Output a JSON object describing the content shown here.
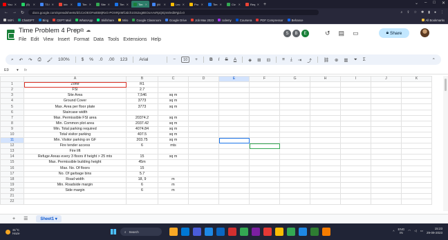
{
  "browser": {
    "tabs": [
      {
        "label": "You",
        "color": "#ff0000"
      },
      {
        "label": "(5)",
        "color": "#25d366"
      },
      {
        "label": "T3 /",
        "color": "#4285f4"
      },
      {
        "label": "Inb",
        "color": "#ea4335"
      },
      {
        "label": "Tim",
        "color": "#1a73e8"
      },
      {
        "label": "Site",
        "color": "#34a853"
      },
      {
        "label": "Tim",
        "color": "#1a73e8"
      },
      {
        "label": "Tim",
        "color": "#188038",
        "active": true
      },
      {
        "label": "(M",
        "color": "#4285f4"
      },
      {
        "label": "Lec",
        "color": "#fbbc04"
      },
      {
        "label": "Pro",
        "color": "#fbbc04"
      },
      {
        "label": "Tim",
        "color": "#1a73e8"
      },
      {
        "label": "Civ",
        "color": "#34a853"
      },
      {
        "label": "Req",
        "color": "#ea4335"
      }
    ],
    "new_tab": "+",
    "window_controls": [
      "⌄",
      "–",
      "□",
      "✕"
    ],
    "url": "docs.google.com/spreadsheets/d/1CxOEOFwEB8jRxG-POXRj4MfiJdch1G52xg8EOxAAvRpQEjm8/edit#gid=0",
    "bookmarks": [
      {
        "label": "WiFi",
        "color": "#cccccc"
      },
      {
        "label": "ChatGPT",
        "color": "#10a37f"
      },
      {
        "label": "Bing",
        "color": "#0078d4"
      },
      {
        "label": "CEPT Mail",
        "color": "#ea4335"
      },
      {
        "label": "WhatsApp",
        "color": "#25d366"
      },
      {
        "label": "Skillshare",
        "color": "#00ff84"
      },
      {
        "label": "Miro",
        "color": "#ffd02f"
      },
      {
        "label": "Google Classroom",
        "color": "#34a853"
      },
      {
        "label": "Google Drive",
        "color": "#4285f4"
      },
      {
        "label": "Job Max 2023",
        "color": "#ea4335"
      },
      {
        "label": "Udemy",
        "color": "#a435f0"
      },
      {
        "label": "Coursera",
        "color": "#0056d2"
      },
      {
        "label": "PDF Compressor",
        "color": "#e53935"
      },
      {
        "label": "Behance",
        "color": "#1769ff"
      }
    ],
    "all_bookmarks": "All Bookmarks"
  },
  "doc": {
    "title": "Time Problem 4 Prep",
    "menu": [
      "File",
      "Edit",
      "View",
      "Insert",
      "Format",
      "Data",
      "Tools",
      "Extensions",
      "Help"
    ],
    "collaborators": [
      {
        "initial": "S",
        "color": "#5f6368"
      },
      {
        "initial": "B",
        "color": "#5f6368"
      },
      {
        "initial": "E",
        "color": "#188038"
      }
    ],
    "share_label": "Share"
  },
  "toolbar": {
    "zoom": "100%",
    "currency": "$",
    "percent": "%",
    "dec_less": ".0",
    "dec_more": ".00",
    "number_format": "123",
    "font": "Arial",
    "font_size": "10"
  },
  "formula_bar": {
    "cell_ref": "E9",
    "fx": "fx",
    "value": ""
  },
  "grid": {
    "columns": [
      "A",
      "B",
      "C",
      "D",
      "E",
      "F",
      "G",
      "H",
      "I",
      "J",
      "K"
    ],
    "selected_column": "E",
    "rows": [
      {
        "n": "1",
        "a": "Zone",
        "b": "R1",
        "c": ""
      },
      {
        "n": "2",
        "a": "FSI",
        "b": "2.7",
        "c": ""
      },
      {
        "n": "3",
        "a": "Site Area",
        "b": "7,546",
        "c": "sq m"
      },
      {
        "n": "4",
        "a": "Ground Cover",
        "b": "3773",
        "c": "sq m"
      },
      {
        "n": "5",
        "a": "Max. Area per floor plate",
        "b": "3773",
        "c": "sq m"
      },
      {
        "n": "6",
        "a": "Staircase width",
        "b": "",
        "c": ""
      },
      {
        "n": "7",
        "a": "Max. Permissible FSI area",
        "b": "20374.2",
        "c": "sq m"
      },
      {
        "n": "8",
        "a": "Min. Common plot area",
        "b": "2037.42",
        "c": "sq m"
      },
      {
        "n": "9",
        "a": "Min. Total parking required",
        "b": "4074.84",
        "c": "sq m"
      },
      {
        "n": "10",
        "a": "Total visitor parking",
        "b": "407.5",
        "c": "sq m"
      },
      {
        "n": "11",
        "a": "Min. Visitor parking on GF",
        "b": "203.75",
        "c": "sq m"
      },
      {
        "n": "12",
        "a": "Fire tender access",
        "b": "6",
        "c": "mts"
      },
      {
        "n": "13",
        "a": "Fire lift",
        "b": "",
        "c": ""
      },
      {
        "n": "14",
        "a": "Refuge Areas every 3 floors if height > 25 mts",
        "b": "15",
        "c": "sq m"
      },
      {
        "n": "15",
        "a": "Max. Permissible building height",
        "b": "45m",
        "c": ""
      },
      {
        "n": "16",
        "a": "Max. No. Of floors",
        "b": "15",
        "c": ""
      },
      {
        "n": "17",
        "a": "No. Of garbage bins",
        "b": "5.7",
        "c": ""
      },
      {
        "n": "18",
        "a": "Road width",
        "b": "18, 9",
        "c": "m"
      },
      {
        "n": "19",
        "a": "Min. Roadside margin",
        "b": "6",
        "c": "m"
      },
      {
        "n": "20",
        "a": "Side margin",
        "b": "6",
        "c": "m"
      },
      {
        "n": "21",
        "a": "",
        "b": "",
        "c": ""
      },
      {
        "n": "22",
        "a": "",
        "b": "",
        "c": ""
      }
    ]
  },
  "sheets": {
    "add": "+",
    "list": "☰",
    "active_sheet": "Sheet1"
  },
  "taskbar": {
    "temperature": "31°C",
    "weather": "Haze",
    "search_placeholder": "Search",
    "apps": [
      "#f9a825",
      "#0078d4",
      "#4a5dd9",
      "#1e88e5",
      "#0a66c2",
      "#d32f2f",
      "#34a853",
      "#7b1fa2",
      "#e53935",
      "#fbbc04",
      "#34a853",
      "#1e88e5",
      "#2e7d32",
      "#f57c00"
    ],
    "lang": "ENG",
    "region": "IN",
    "time": "15:23",
    "date": "29-09-2023"
  }
}
